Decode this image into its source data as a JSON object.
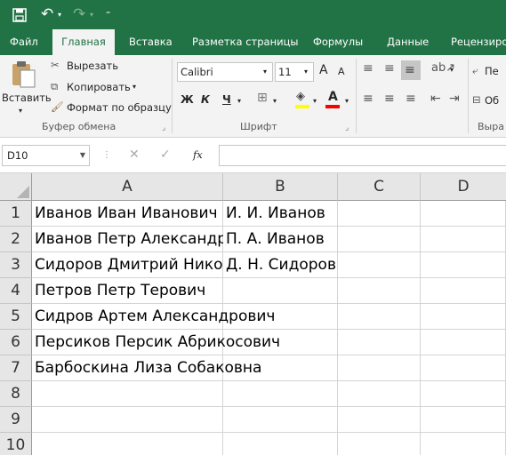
{
  "ribbon_tabs": [
    "Файл",
    "Главная",
    "Вставка",
    "Разметка страницы",
    "Формулы",
    "Данные",
    "Рецензиров"
  ],
  "clipboard": {
    "paste": "Вставить",
    "cut": "Вырезать",
    "copy": "Копировать",
    "format_painter": "Формат по образцу",
    "group": "Буфер обмена"
  },
  "font": {
    "name": "Calibri",
    "size": "11",
    "bold": "Ж",
    "italic": "К",
    "underline": "Ч",
    "grow": "A",
    "shrink": "A",
    "group": "Шрифт"
  },
  "alignment": {
    "group": "Выра",
    "wrap": "Пе",
    "merge": "Об"
  },
  "formula_bar": {
    "name_box": "D10",
    "fx": "fx",
    "value": ""
  },
  "columns": [
    "A",
    "B",
    "C",
    "D"
  ],
  "rows": [
    {
      "num": "1",
      "a": "Иванов Иван Иванович",
      "b": "И. И. Иванов"
    },
    {
      "num": "2",
      "a": "Иванов Петр Александрович",
      "b": "П. А. Иванов"
    },
    {
      "num": "3",
      "a": "Сидоров Дмитрий Николаевич",
      "b": "Д. Н. Сидоров"
    },
    {
      "num": "4",
      "a": "Петров Петр Терович",
      "b": ""
    },
    {
      "num": "5",
      "a": "Сидров Артем Александрович",
      "b": ""
    },
    {
      "num": "6",
      "a": "Персиков Персик Абрикосович",
      "b": ""
    },
    {
      "num": "7",
      "a": "Барбоскина Лиза Собаковна",
      "b": ""
    },
    {
      "num": "8",
      "a": "",
      "b": ""
    },
    {
      "num": "9",
      "a": "",
      "b": ""
    },
    {
      "num": "10",
      "a": "",
      "b": ""
    }
  ],
  "colors": {
    "brand": "#217346",
    "highlight": "#ffff00",
    "font_color": "#ff0000"
  }
}
